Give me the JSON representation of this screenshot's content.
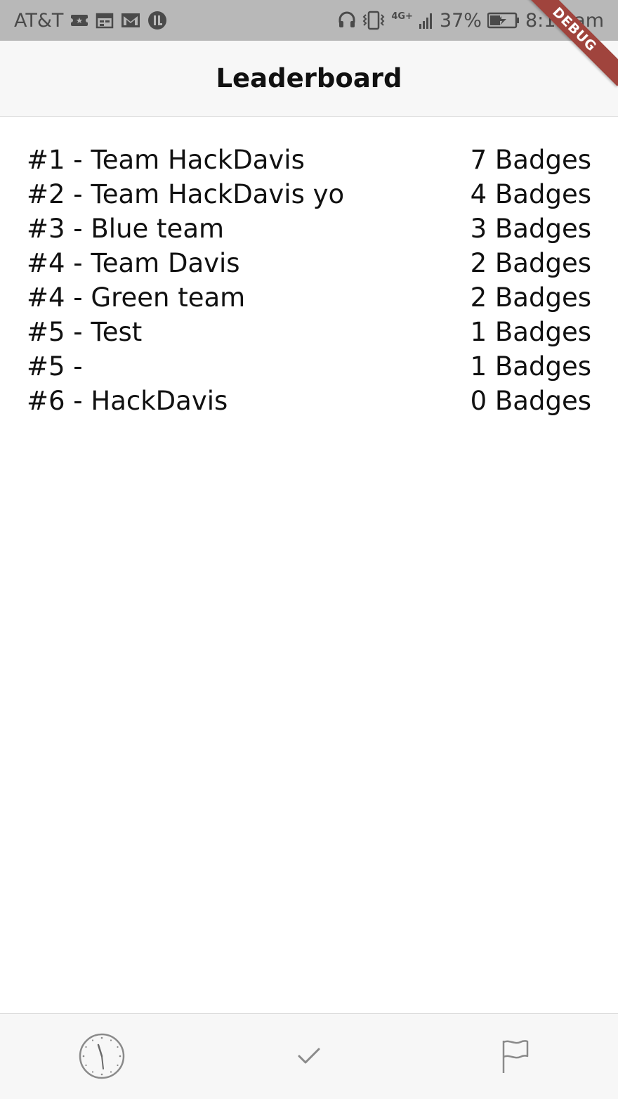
{
  "status_bar": {
    "carrier": "AT&T",
    "network": "4G+",
    "battery_percent": "37%",
    "time": "8:15 am",
    "left_icons": [
      "ticket-icon",
      "calendar-icon",
      "gmail-icon",
      "app-badge-icon"
    ],
    "right_icons": [
      "headset-icon",
      "vibrate-icon",
      "signal-icon",
      "battery-icon"
    ]
  },
  "debug_banner": "DEBUG",
  "app_bar": {
    "title": "Leaderboard"
  },
  "leaderboard": [
    {
      "left": "#1 - Team HackDavis",
      "right": "7 Badges"
    },
    {
      "left": "#2 - Team HackDavis yo",
      "right": "4 Badges"
    },
    {
      "left": "#3 - Blue team",
      "right": "3 Badges"
    },
    {
      "left": "#4 - Team Davis",
      "right": "2 Badges"
    },
    {
      "left": "#4 - Green team",
      "right": "2 Badges"
    },
    {
      "left": "#5 - Test",
      "right": "1 Badges"
    },
    {
      "left": "#5 - ",
      "right": "1 Badges"
    },
    {
      "left": "#6 - HackDavis",
      "right": "0 Badges"
    }
  ],
  "bottom_nav": {
    "items": [
      {
        "icon": "clock-icon"
      },
      {
        "icon": "check-icon"
      },
      {
        "icon": "flag-icon"
      }
    ]
  },
  "colors": {
    "status_bar_bg": "#b8b8b8",
    "app_bar_bg": "#f7f7f7",
    "ribbon": "#a0443d",
    "text": "#111111",
    "icon": "#8a8a8a"
  }
}
